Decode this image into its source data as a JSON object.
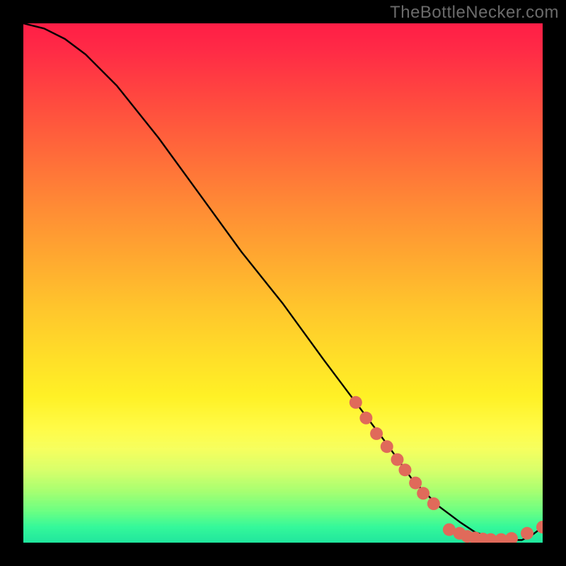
{
  "watermark": "TheBottleNecker.com",
  "chart_data": {
    "type": "line",
    "title": "",
    "xlabel": "",
    "ylabel": "",
    "xlim": [
      0,
      100
    ],
    "ylim": [
      0,
      100
    ],
    "grid": false,
    "legend": false,
    "series": [
      {
        "name": "curve",
        "color": "#000000",
        "x": [
          0,
          4,
          8,
          12,
          18,
          26,
          34,
          42,
          50,
          58,
          64,
          70,
          75,
          80,
          84,
          87,
          90,
          93,
          96,
          98,
          100
        ],
        "y": [
          100,
          99,
          97,
          94,
          88,
          78,
          67,
          56,
          46,
          35,
          27,
          19,
          12,
          7,
          4,
          2,
          1,
          0.5,
          0.5,
          1.5,
          3
        ]
      }
    ],
    "markers": [
      {
        "name": "dots",
        "color": "#e06a5a",
        "radius": 9,
        "points": [
          {
            "x": 64,
            "y": 27
          },
          {
            "x": 66,
            "y": 24
          },
          {
            "x": 68,
            "y": 21
          },
          {
            "x": 70,
            "y": 18.5
          },
          {
            "x": 72,
            "y": 16
          },
          {
            "x": 73.5,
            "y": 14
          },
          {
            "x": 75.5,
            "y": 11.5
          },
          {
            "x": 77,
            "y": 9.5
          },
          {
            "x": 79,
            "y": 7.5
          },
          {
            "x": 82,
            "y": 2.5
          },
          {
            "x": 84,
            "y": 1.8
          },
          {
            "x": 85.5,
            "y": 1.2
          },
          {
            "x": 87,
            "y": 0.9
          },
          {
            "x": 88.5,
            "y": 0.7
          },
          {
            "x": 90,
            "y": 0.6
          },
          {
            "x": 92,
            "y": 0.6
          },
          {
            "x": 94,
            "y": 0.8
          },
          {
            "x": 97,
            "y": 1.8
          },
          {
            "x": 100,
            "y": 3
          }
        ]
      }
    ],
    "background": {
      "type": "vertical-gradient",
      "stops": [
        {
          "pos": 0.0,
          "color": "#ff1e46"
        },
        {
          "pos": 0.5,
          "color": "#ffc62c"
        },
        {
          "pos": 0.78,
          "color": "#fffb47"
        },
        {
          "pos": 1.0,
          "color": "#20e69d"
        }
      ]
    }
  }
}
